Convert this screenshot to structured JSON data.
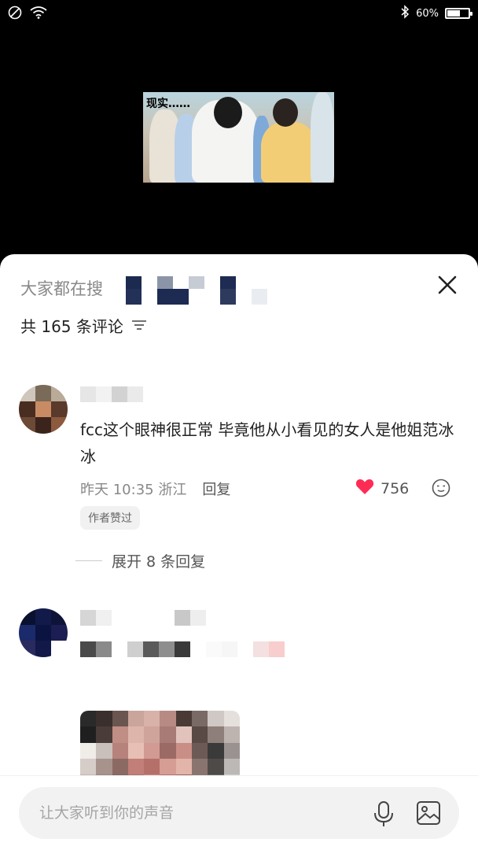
{
  "status_bar": {
    "battery_text": "60%",
    "battery_level": 0.6,
    "icons": [
      "do-not-disturb-icon",
      "wifi-icon",
      "bluetooth-icon",
      "battery-icon"
    ]
  },
  "video": {
    "caption": "现实……"
  },
  "sheet": {
    "header_prefix": "大家都在搜",
    "comment_count": "共 165 条评论"
  },
  "comments": [
    {
      "text": "fcc这个眼神很正常 毕竟他从小看见的女人是他姐范冰冰",
      "time": "昨天 10:35",
      "location": "浙江",
      "reply_label": "回复",
      "likes": "756",
      "author_badge": "作者赞过",
      "expand_label": "展开 8 条回复"
    }
  ],
  "input": {
    "placeholder": "让大家听到你的声音"
  },
  "colors": {
    "like_heart": "#fe2c55",
    "sheet_bg": "#ffffff",
    "input_bg": "#f2f2f2"
  }
}
